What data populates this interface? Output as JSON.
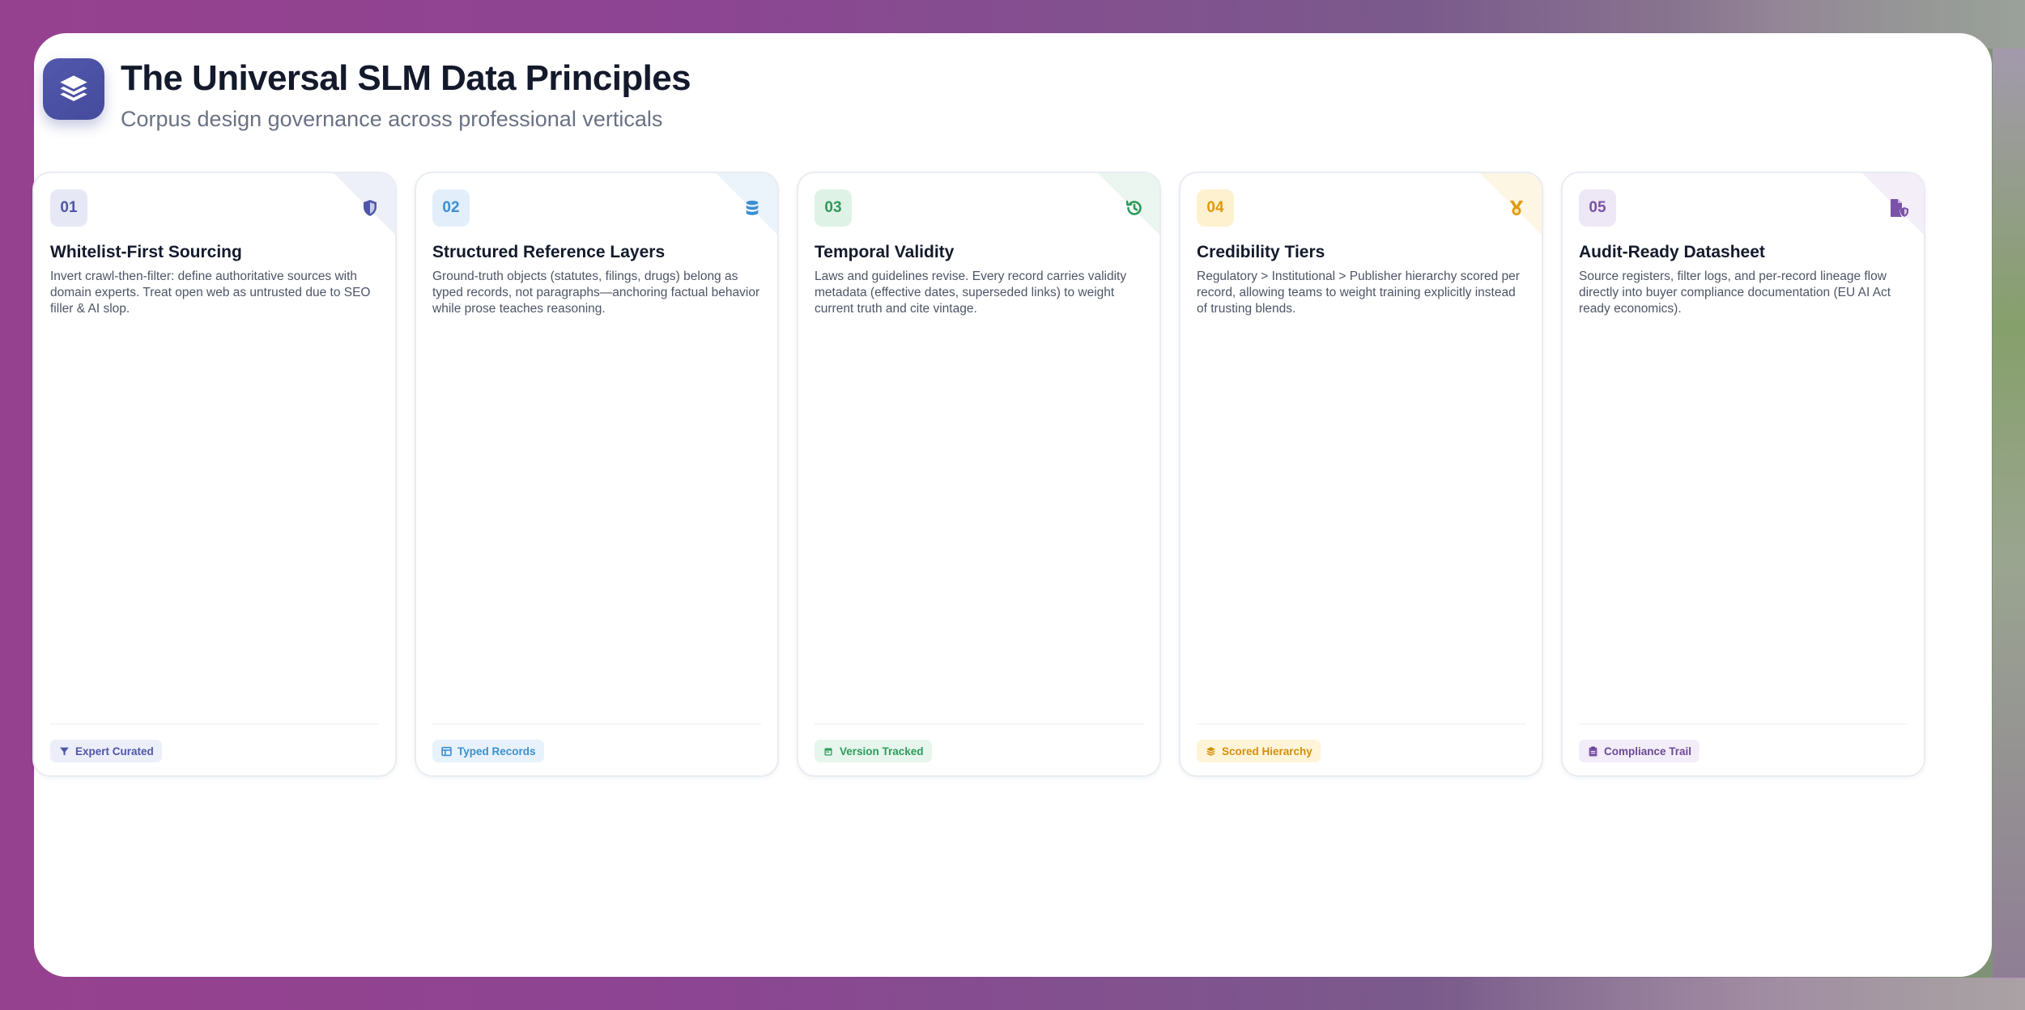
{
  "header": {
    "title": "The Universal SLM Data Principles",
    "subtitle": "Corpus design governance across professional verticals",
    "icon": "layers-icon"
  },
  "cards": [
    {
      "number": "01",
      "title": "Whitelist-First Sourcing",
      "description": "Invert crawl-then-filter: define authoritative sources with domain experts. Treat open web as untrusted due to SEO filler & AI slop.",
      "tag": "Expert Curated",
      "icon": "shield-icon",
      "tag_icon": "filter-icon",
      "accent": "#4f56a8",
      "badge_bg": "#e6e8f5",
      "tag_bg": "#eceefa"
    },
    {
      "number": "02",
      "title": "Structured Reference Layers",
      "description": "Ground-truth objects (statutes, filings, drugs) belong as typed records, not paragraphs—anchoring factual behavior while prose teaches reasoning.",
      "tag": "Typed Records",
      "icon": "database-icon",
      "tag_icon": "table-icon",
      "accent": "#3c8fd0",
      "badge_bg": "#e2eefa",
      "tag_bg": "#e8f2fc"
    },
    {
      "number": "03",
      "title": "Temporal Validity",
      "description": "Laws and guidelines revise. Every record carries validity metadata (effective dates, superseded links) to weight current truth and cite vintage.",
      "tag": "Version Tracked",
      "icon": "history-icon",
      "tag_icon": "calendar-icon",
      "accent": "#2f9a5b",
      "badge_bg": "#dff2e6",
      "tag_bg": "#e6f6ec"
    },
    {
      "number": "04",
      "title": "Credibility Tiers",
      "description": "Regulatory > Institutional > Publisher hierarchy scored per record, allowing teams to weight training explicitly instead of trusting blends.",
      "tag": "Scored Hierarchy",
      "icon": "medal-icon",
      "tag_icon": "layers-icon",
      "accent": "#df9a12",
      "badge_bg": "#fdf1cf",
      "tag_bg": "#fff4d8"
    },
    {
      "number": "05",
      "title": "Audit-Ready Datasheet",
      "description": "Source registers, filter logs, and per-record lineage flow directly into buyer compliance documentation (EU AI Act ready economics).",
      "tag": "Compliance Trail",
      "icon": "file-shield-icon",
      "tag_icon": "clipboard-icon",
      "accent": "#7a52a8",
      "badge_bg": "#eee7f6",
      "tag_bg": "#f3edf9"
    }
  ]
}
